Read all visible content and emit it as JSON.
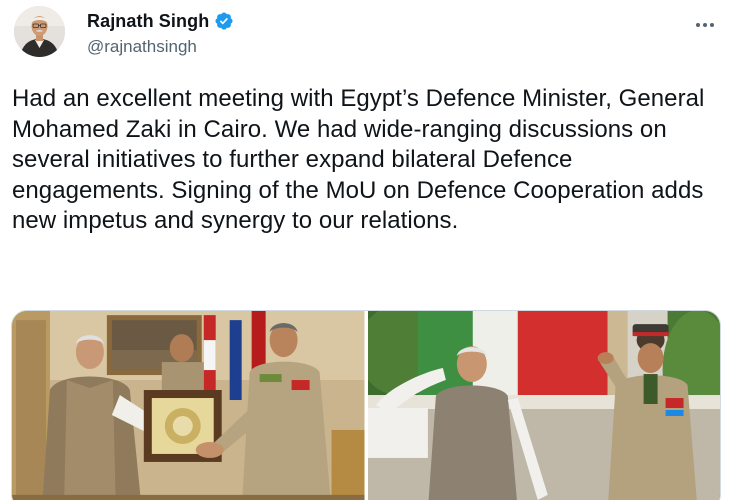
{
  "author": {
    "display_name": "Rajnath Singh",
    "handle": "@rajnathsingh",
    "verified": true,
    "avatar_icon": "profile-photo"
  },
  "tweet": {
    "text": "Had an excellent meeting with Egypt’s Defence Minister, General Mohamed Zaki in Cairo. We had wide-ranging discussions on several initiatives to further expand bilateral Defence engagements. Signing of the MoU on Defence Cooperation adds new impetus and synergy to our relations."
  },
  "media": {
    "count": 2,
    "photos": [
      {
        "icon": "photo-meeting-handshake"
      },
      {
        "icon": "photo-salute-ceremony"
      }
    ]
  },
  "colors": {
    "verified_blue": "#1d9bf0",
    "text_primary": "#0f1419",
    "text_secondary": "#536471",
    "border": "#cfd9de"
  },
  "icons": {
    "verified": "verified-badge-icon",
    "more": "more-horizontal-icon"
  }
}
